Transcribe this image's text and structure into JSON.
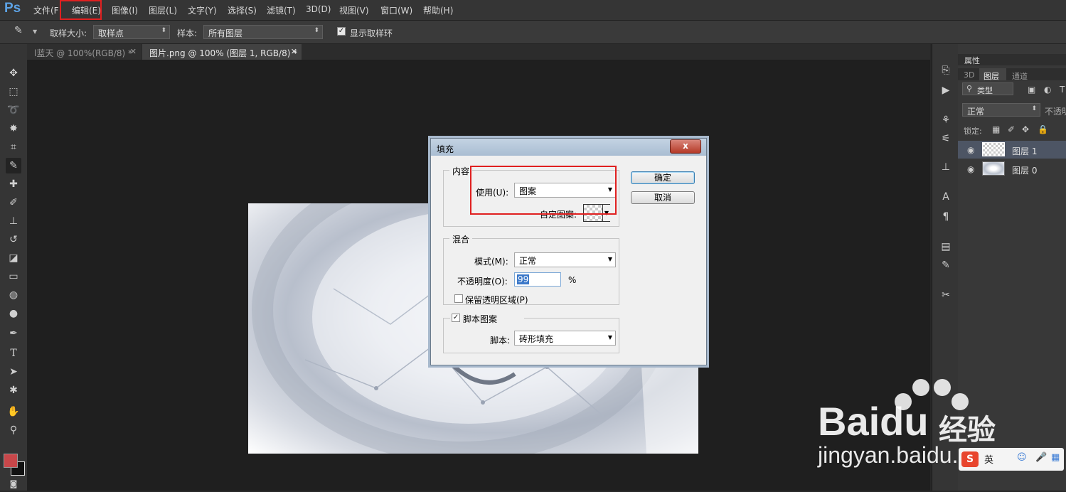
{
  "app": {
    "logo": "Ps"
  },
  "menu": {
    "items": [
      "文件(F",
      "编辑(E)",
      "图像(I)",
      "图层(L)",
      "文字(Y)",
      "选择(S)",
      "滤镜(T)",
      "3D(D)",
      "视图(V)",
      "窗口(W)",
      "帮助(H)"
    ]
  },
  "options": {
    "sample_size_label": "取样大小:",
    "sample_size_value": "取样点",
    "sample_label": "样本:",
    "sample_value": "所有图层",
    "show_ring_label": "显示取样环"
  },
  "tabs": [
    {
      "label": "l蓝天 @ 100%(RGB/8) *"
    },
    {
      "label": "图片.png @ 100% (图层 1, RGB/8) *"
    }
  ],
  "panels": {
    "properties_label": "属性",
    "tabs": [
      "3D",
      "图层",
      "通道"
    ],
    "kind_label": "类型",
    "blend_mode": "正常",
    "opacity_label": "不透明",
    "lock_label": "锁定:",
    "layers": [
      {
        "name": "图层 1"
      },
      {
        "name": "图层 0"
      }
    ]
  },
  "dialog": {
    "title": "填充",
    "close_glyph": "x",
    "content_group": "内容",
    "use_label": "使用(U):",
    "use_value": "图案",
    "custom_pattern_label": "自定图案:",
    "blend_group": "混合",
    "mode_label": "模式(M):",
    "mode_value": "正常",
    "opacity_label": "不透明度(O):",
    "opacity_value": "99",
    "percent": "%",
    "preserve_label": "保留透明区域(P)",
    "script_check_label": "脚本图案",
    "script_label": "脚本:",
    "script_value": "砖形填充",
    "ok": "确定",
    "cancel": "取消"
  },
  "watermark": {
    "brand": "Bai",
    "brand_tail": "du",
    "product": "经验",
    "url": "jingyan.baidu.com"
  },
  "colors": {
    "accent_blue": "#5da3e6",
    "foreground": "#c8474a",
    "highlight_red": "#e02020"
  }
}
